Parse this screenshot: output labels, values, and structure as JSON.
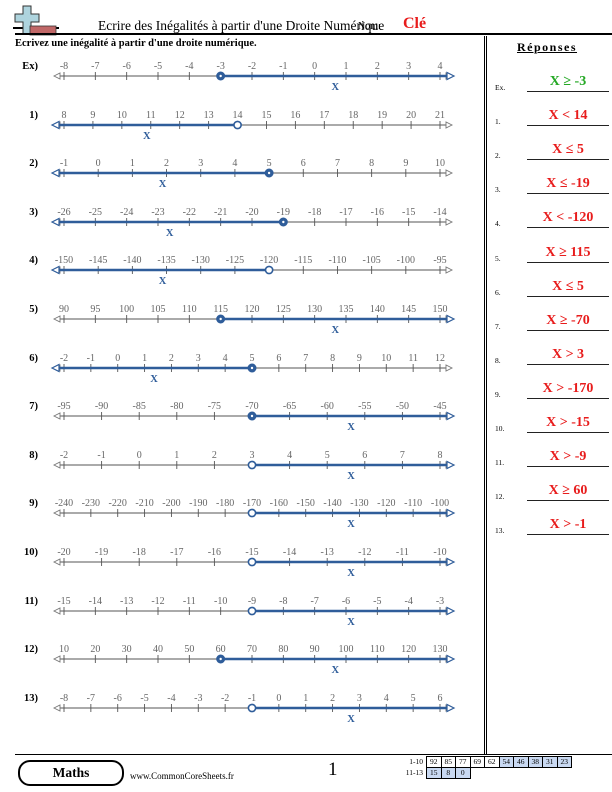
{
  "header": {
    "logo_icon": "plus-minus-logo-icon",
    "title": "Ecrire des Inégalités à partir d'une Droite Numérique",
    "name_label": "Nom:",
    "name_value": "Clé",
    "instructions": "Ecrivez une inégalité à partir d'une droite numérique."
  },
  "colors": {
    "line_blue": "#2f5d9a",
    "axis_gray": "#777777",
    "answer_red": "#e81c1c",
    "example_green": "#24a824",
    "score_blue": "#c9d9f2"
  },
  "answers": {
    "heading": "Réponses",
    "items": [
      {
        "num": "Ex.",
        "value": "X ≥ -3",
        "example": true
      },
      {
        "num": "1.",
        "value": "X < 14"
      },
      {
        "num": "2.",
        "value": "X ≤ 5"
      },
      {
        "num": "3.",
        "value": "X ≤ -19"
      },
      {
        "num": "4.",
        "value": "X < -120"
      },
      {
        "num": "5.",
        "value": "X ≥ 115"
      },
      {
        "num": "6.",
        "value": "X ≤ 5"
      },
      {
        "num": "7.",
        "value": "X ≥ -70"
      },
      {
        "num": "8.",
        "value": "X > 3"
      },
      {
        "num": "9.",
        "value": "X > -170"
      },
      {
        "num": "10.",
        "value": "X > -15"
      },
      {
        "num": "11.",
        "value": "X > -9"
      },
      {
        "num": "12.",
        "value": "X ≥ 60"
      },
      {
        "num": "13.",
        "value": "X > -1"
      }
    ]
  },
  "problems": [
    {
      "label": "Ex)",
      "ticks": [
        -8,
        -7,
        -6,
        -5,
        -4,
        -3,
        -2,
        -1,
        0,
        1,
        2,
        3,
        4
      ],
      "point": -3,
      "closed": true,
      "direction": "right",
      "var": "X"
    },
    {
      "label": "1)",
      "ticks": [
        8,
        9,
        10,
        11,
        12,
        13,
        14,
        15,
        16,
        17,
        18,
        19,
        20,
        21
      ],
      "point": 14,
      "closed": false,
      "direction": "left",
      "var": "X"
    },
    {
      "label": "2)",
      "ticks": [
        -1,
        0,
        1,
        2,
        3,
        4,
        5,
        6,
        7,
        8,
        9,
        10
      ],
      "point": 5,
      "closed": true,
      "direction": "left",
      "var": "X"
    },
    {
      "label": "3)",
      "ticks": [
        -26,
        -25,
        -24,
        -23,
        -22,
        -21,
        -20,
        -19,
        -18,
        -17,
        -16,
        -15,
        -14
      ],
      "point": -19,
      "closed": true,
      "direction": "left",
      "var": "X"
    },
    {
      "label": "4)",
      "ticks": [
        -150,
        -145,
        -140,
        -135,
        -130,
        -125,
        -120,
        -115,
        -110,
        -105,
        -100,
        -95
      ],
      "point": -120,
      "closed": false,
      "direction": "left",
      "var": "X"
    },
    {
      "label": "5)",
      "ticks": [
        90,
        95,
        100,
        105,
        110,
        115,
        120,
        125,
        130,
        135,
        140,
        145,
        150
      ],
      "point": 115,
      "closed": true,
      "direction": "right",
      "var": "X"
    },
    {
      "label": "6)",
      "ticks": [
        -2,
        -1,
        0,
        1,
        2,
        3,
        4,
        5,
        6,
        7,
        8,
        9,
        10,
        11,
        12
      ],
      "point": 5,
      "closed": true,
      "direction": "left",
      "var": "X"
    },
    {
      "label": "7)",
      "ticks": [
        -95,
        -90,
        -85,
        -80,
        -75,
        -70,
        -65,
        -60,
        -55,
        -50,
        -45
      ],
      "point": -70,
      "closed": true,
      "direction": "right",
      "var": "X"
    },
    {
      "label": "8)",
      "ticks": [
        -2,
        -1,
        0,
        1,
        2,
        3,
        4,
        5,
        6,
        7,
        8
      ],
      "point": 3,
      "closed": false,
      "direction": "right",
      "var": "X"
    },
    {
      "label": "9)",
      "ticks": [
        -240,
        -230,
        -220,
        -210,
        -200,
        -190,
        -180,
        -170,
        -160,
        -150,
        -140,
        -130,
        -120,
        -110,
        -100
      ],
      "point": -170,
      "closed": false,
      "direction": "right",
      "var": "X"
    },
    {
      "label": "10)",
      "ticks": [
        -20,
        -19,
        -18,
        -17,
        -16,
        -15,
        -14,
        -13,
        -12,
        -11,
        -10
      ],
      "point": -15,
      "closed": false,
      "direction": "right",
      "var": "X"
    },
    {
      "label": "11)",
      "ticks": [
        -15,
        -14,
        -13,
        -12,
        -11,
        -10,
        -9,
        -8,
        -7,
        -6,
        -5,
        -4,
        -3
      ],
      "point": -9,
      "closed": false,
      "direction": "right",
      "var": "X"
    },
    {
      "label": "12)",
      "ticks": [
        10,
        20,
        30,
        40,
        50,
        60,
        70,
        80,
        90,
        100,
        110,
        120,
        130
      ],
      "point": 60,
      "closed": true,
      "direction": "right",
      "var": "X"
    },
    {
      "label": "13)",
      "ticks": [
        -8,
        -7,
        -6,
        -5,
        -4,
        -3,
        -2,
        -1,
        0,
        1,
        2,
        3,
        4,
        5,
        6
      ],
      "point": -1,
      "closed": false,
      "direction": "right",
      "var": "X"
    }
  ],
  "footer": {
    "subject": "Maths",
    "site": "www.CommonCoreSheets.fr",
    "page": "1",
    "score_rows": [
      {
        "label": "1-10",
        "cells": [
          "92",
          "85",
          "77",
          "69",
          "62",
          "54",
          "46",
          "38",
          "31",
          "23"
        ],
        "blue_from": 5
      },
      {
        "label": "11-13",
        "cells": [
          "15",
          "8",
          "0"
        ],
        "blue_from": 0
      }
    ]
  }
}
